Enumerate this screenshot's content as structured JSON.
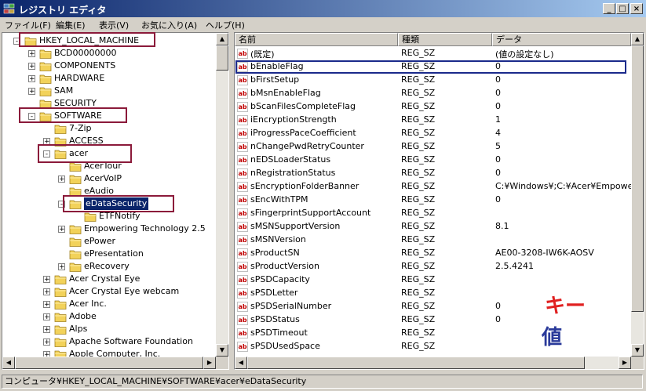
{
  "window": {
    "title": "レジストリ エディタ",
    "controls": {
      "minimize": "_",
      "maximize": "□",
      "close": "×"
    }
  },
  "menu": [
    "ファイル(F)",
    "編集(E)",
    "表示(V)",
    "お気に入り(A)",
    "ヘルプ(H)"
  ],
  "tree": [
    {
      "label": "HKEY_LOCAL_MACHINE",
      "expander": "-"
    },
    {
      "label": "BCD00000000",
      "expander": "+"
    },
    {
      "label": "COMPONENTS",
      "expander": "+"
    },
    {
      "label": "HARDWARE",
      "expander": "+"
    },
    {
      "label": "SAM",
      "expander": "+"
    },
    {
      "label": "SECURITY",
      "expander": ""
    },
    {
      "label": "SOFTWARE",
      "expander": "-"
    },
    {
      "label": "7-Zip",
      "expander": ""
    },
    {
      "label": "ACCESS",
      "expander": "+"
    },
    {
      "label": "acer",
      "expander": "-"
    },
    {
      "label": "AcerTour",
      "expander": ""
    },
    {
      "label": "AcerVoIP",
      "expander": "+"
    },
    {
      "label": "eAudio",
      "expander": ""
    },
    {
      "label": "eDataSecurity",
      "expander": "-",
      "selected": true
    },
    {
      "label": "ETFNotify",
      "expander": ""
    },
    {
      "label": "Empowering Technology 2.5",
      "expander": "+"
    },
    {
      "label": "ePower",
      "expander": ""
    },
    {
      "label": "ePresentation",
      "expander": ""
    },
    {
      "label": "eRecovery",
      "expander": "+"
    },
    {
      "label": "Acer Crystal Eye",
      "expander": "+"
    },
    {
      "label": "Acer Crystal Eye webcam",
      "expander": "+"
    },
    {
      "label": "Acer Inc.",
      "expander": "+"
    },
    {
      "label": "Adobe",
      "expander": "+"
    },
    {
      "label": "Alps",
      "expander": "+"
    },
    {
      "label": "Apache Software Foundation",
      "expander": "+"
    },
    {
      "label": "Apple Computer, Inc.",
      "expander": "+"
    }
  ],
  "columns": {
    "name": "名前",
    "type": "種類",
    "data": "データ"
  },
  "values": [
    {
      "name": "(既定)",
      "type": "REG_SZ",
      "data": "(値の設定なし)"
    },
    {
      "name": "bEnableFlag",
      "type": "REG_SZ",
      "data": "0"
    },
    {
      "name": "bFirstSetup",
      "type": "REG_SZ",
      "data": "0"
    },
    {
      "name": "bMsnEnableFlag",
      "type": "REG_SZ",
      "data": "0"
    },
    {
      "name": "bScanFilesCompleteFlag",
      "type": "REG_SZ",
      "data": "0"
    },
    {
      "name": "iEncryptionStrength",
      "type": "REG_SZ",
      "data": "1"
    },
    {
      "name": "iProgressPaceCoefficient",
      "type": "REG_SZ",
      "data": "4"
    },
    {
      "name": "nChangePwdRetryCounter",
      "type": "REG_SZ",
      "data": "5"
    },
    {
      "name": "nEDSLoaderStatus",
      "type": "REG_SZ",
      "data": "0"
    },
    {
      "name": "nRegistrationStatus",
      "type": "REG_SZ",
      "data": "0"
    },
    {
      "name": "sEncryptionFolderBanner",
      "type": "REG_SZ",
      "data": "C:¥Windows¥;C:¥Acer¥Empowerin"
    },
    {
      "name": "sEncWithTPM",
      "type": "REG_SZ",
      "data": "0"
    },
    {
      "name": "sFingerprintSupportAccount",
      "type": "REG_SZ",
      "data": ""
    },
    {
      "name": "sMSNSupportVersion",
      "type": "REG_SZ",
      "data": "8.1"
    },
    {
      "name": "sMSNVersion",
      "type": "REG_SZ",
      "data": ""
    },
    {
      "name": "sProductSN",
      "type": "REG_SZ",
      "data": "AE00-3208-IW6K-AOSV"
    },
    {
      "name": "sProductVersion",
      "type": "REG_SZ",
      "data": "2.5.4241"
    },
    {
      "name": "sPSDCapacity",
      "type": "REG_SZ",
      "data": ""
    },
    {
      "name": "sPSDLetter",
      "type": "REG_SZ",
      "data": ""
    },
    {
      "name": "sPSDSerialNumber",
      "type": "REG_SZ",
      "data": "0"
    },
    {
      "name": "sPSDStatus",
      "type": "REG_SZ",
      "data": "0"
    },
    {
      "name": "sPSDTimeout",
      "type": "REG_SZ",
      "data": ""
    },
    {
      "name": "sPSDUsedSpace",
      "type": "REG_SZ",
      "data": ""
    }
  ],
  "icon_text": "ab",
  "annotations": {
    "key_label": "キー",
    "value_label": "値",
    "key_color": "#e02020",
    "value_color": "#2a3a9a"
  },
  "status": "コンピュータ¥HKEY_LOCAL_MACHINE¥SOFTWARE¥acer¥eDataSecurity"
}
